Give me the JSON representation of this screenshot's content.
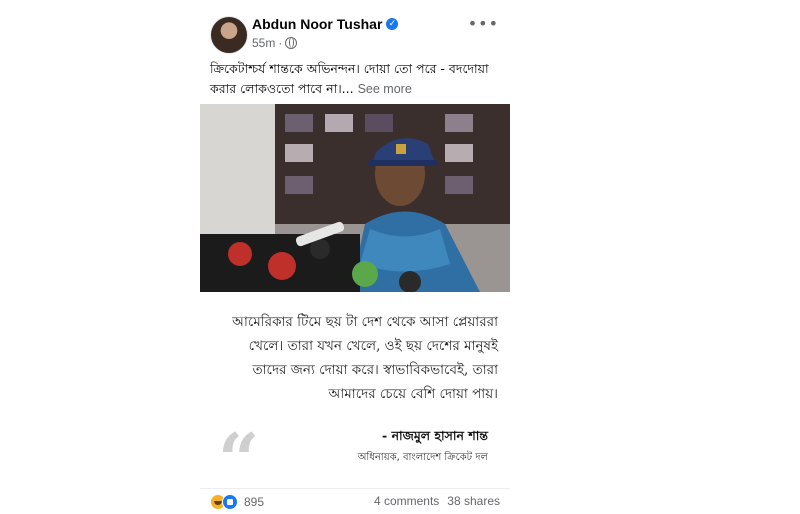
{
  "post": {
    "author": "Abdun Noor Tushar",
    "time": "55m",
    "caption": "ক্রিকেটাশ্চর্য শান্তকে অভিনন্দন। দোয়া তো পরে - বদদোয়া করার লোকওতো পাবে না।...",
    "see_more": "See more",
    "quote": {
      "text": "আমেরিকার টিমে ছয় টা দেশ থেকে আসা প্লেয়াররা খেলে। তারা যখন খেলে, ওই ছয় দেশের মানুষই তাদের জন্য দোয়া করে। স্বাভাবিকভাবেই, তারা আমাদের চেয়ে বেশি দোয়া পায়।",
      "author": "- নাজমুল হাসান শান্ত",
      "role": "অধিনায়ক, বাংলাদেশ ক্রিকেট দল"
    },
    "reactions_count": "895",
    "comments": "4 comments",
    "shares": "38 shares"
  },
  "icons": [
    "verified-icon",
    "globe-icon",
    "more-options-icon",
    "haha-reaction-icon",
    "like-reaction-icon",
    "quote-mark-icon"
  ],
  "colors": {
    "verified": "#1877f2",
    "meta_text": "#65676b",
    "haha": "#f7b125",
    "like": "#1877f2",
    "quote_mark": "#cfcfcf"
  }
}
